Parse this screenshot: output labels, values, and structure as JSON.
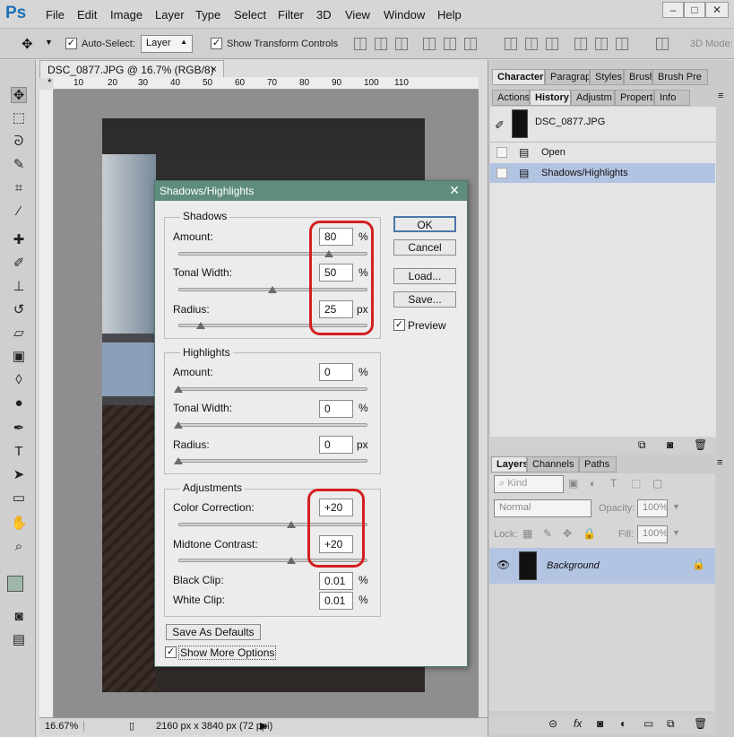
{
  "app": {
    "logo": "Ps"
  },
  "menu": [
    "File",
    "Edit",
    "Image",
    "Layer",
    "Type",
    "Select",
    "Filter",
    "3D",
    "View",
    "Window",
    "Help"
  ],
  "options_bar": {
    "auto_select_label": "Auto-Select:",
    "auto_select_value": "Layer",
    "show_transform_label": "Show Transform Controls",
    "mode_3d_label": "3D Mode:"
  },
  "document": {
    "tab_title": "DSC_0877.JPG @ 16.7% (RGB/8) *",
    "ruler_ticks": [
      "10",
      "60",
      "10",
      "20",
      "30",
      "40",
      "50",
      "60",
      "70",
      "80",
      "90",
      "100",
      "110"
    ],
    "zoom": "16.67%",
    "doc_info": "2160 px x 3840 px (72 ppi)"
  },
  "panels": {
    "top_tabs": [
      "Character",
      "Paragrapl",
      "Styles",
      "Brush",
      "Brush Pre"
    ],
    "second_tabs": [
      "Actions",
      "History",
      "Adjustm",
      "Properti",
      "Info"
    ],
    "history_snapshot": "DSC_0877.JPG",
    "history_items": [
      "Open",
      "Shadows/Highlights"
    ],
    "layers_tabs": [
      "Layers",
      "Channels",
      "Paths"
    ],
    "layers_kind": "Kind",
    "blend_mode": "Normal",
    "opacity_label": "Opacity:",
    "opacity_value": "100%",
    "lock_label": "Lock:",
    "fill_label": "Fill:",
    "fill_value": "100%",
    "layer_name": "Background"
  },
  "dialog": {
    "title": "Shadows/Highlights",
    "shadows": {
      "title": "Shadows",
      "amount_label": "Amount:",
      "amount_value": "80",
      "amount_unit": "%",
      "tonal_label": "Tonal Width:",
      "tonal_value": "50",
      "tonal_unit": "%",
      "radius_label": "Radius:",
      "radius_value": "25",
      "radius_unit": "px"
    },
    "highlights": {
      "title": "Highlights",
      "amount_label": "Amount:",
      "amount_value": "0",
      "amount_unit": "%",
      "tonal_label": "Tonal Width:",
      "tonal_value": "0",
      "tonal_unit": "%",
      "radius_label": "Radius:",
      "radius_value": "0",
      "radius_unit": "px"
    },
    "adjustments": {
      "title": "Adjustments",
      "color_label": "Color Correction:",
      "color_value": "+20",
      "midtone_label": "Midtone Contrast:",
      "midtone_value": "+20",
      "black_label": "Black Clip:",
      "black_value": "0.01",
      "black_unit": "%",
      "white_label": "White Clip:",
      "white_value": "0.01",
      "white_unit": "%"
    },
    "buttons": {
      "ok": "OK",
      "cancel": "Cancel",
      "load": "Load...",
      "save": "Save..."
    },
    "preview_label": "Preview",
    "save_defaults": "Save As Defaults",
    "show_more": "Show More Options"
  }
}
